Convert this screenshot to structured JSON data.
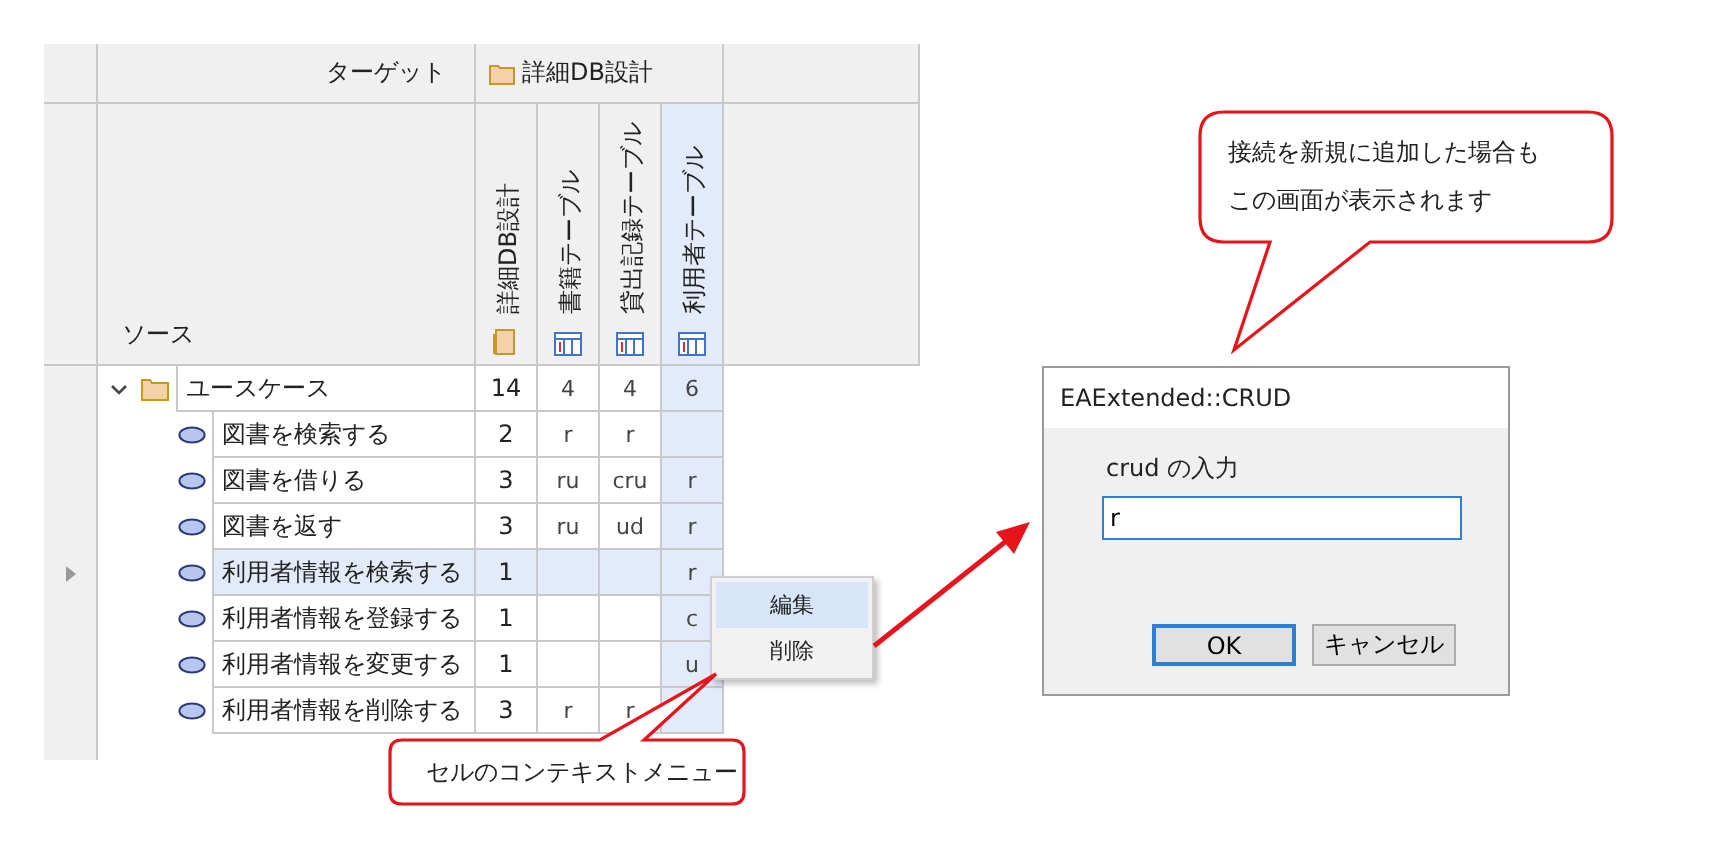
{
  "matrix": {
    "target_label": "ターゲット",
    "target_package": "詳細DB設計",
    "source_label": "ソース",
    "columns": [
      {
        "label": "詳細DB設計",
        "kind": "package",
        "selected": false
      },
      {
        "label": "書籍テーブル",
        "kind": "table",
        "selected": false
      },
      {
        "label": "貸出記録テーブル",
        "kind": "table",
        "selected": false
      },
      {
        "label": "利用者テーブル",
        "kind": "table",
        "selected": true
      }
    ],
    "rows": [
      {
        "name": "ユースケース",
        "kind": "package",
        "expanded": true,
        "selected": false,
        "cells": [
          "14",
          "4",
          "4",
          "6"
        ],
        "children": [
          {
            "name": "図書を検索する",
            "kind": "usecase",
            "selected": false,
            "cells": [
              "2",
              "r",
              "r",
              null
            ]
          },
          {
            "name": "図書を借りる",
            "kind": "usecase",
            "selected": false,
            "cells": [
              "3",
              "ru",
              "cru",
              "r"
            ]
          },
          {
            "name": "図書を返す",
            "kind": "usecase",
            "selected": false,
            "cells": [
              "3",
              "ru",
              "ud",
              "r"
            ]
          },
          {
            "name": "利用者情報を検索する",
            "kind": "usecase",
            "selected": true,
            "cells": [
              "1",
              null,
              null,
              "r"
            ]
          },
          {
            "name": "利用者情報を登録する",
            "kind": "usecase",
            "selected": false,
            "cells": [
              "1",
              null,
              null,
              "c"
            ]
          },
          {
            "name": "利用者情報を変更する",
            "kind": "usecase",
            "selected": false,
            "cells": [
              "1",
              null,
              null,
              "u"
            ]
          },
          {
            "name": "利用者情報を削除する",
            "kind": "usecase",
            "selected": false,
            "cells": [
              "3",
              "r",
              "r",
              null
            ]
          }
        ]
      }
    ]
  },
  "context_menu": {
    "items": [
      {
        "label": "編集",
        "selected": true
      },
      {
        "label": "削除",
        "selected": false
      }
    ]
  },
  "dialog": {
    "title": "EAExtended::CRUD",
    "label": "crud の入力",
    "value": "r",
    "buttons": [
      {
        "label": "OK",
        "default": true
      },
      {
        "label": "キャンセル",
        "default": false
      }
    ]
  },
  "callouts": [
    {
      "lines": [
        "セルのコンテキストメニュー"
      ]
    },
    {
      "lines": [
        "接続を新規に追加した場合も",
        "この画面が表示されます"
      ]
    }
  ]
}
